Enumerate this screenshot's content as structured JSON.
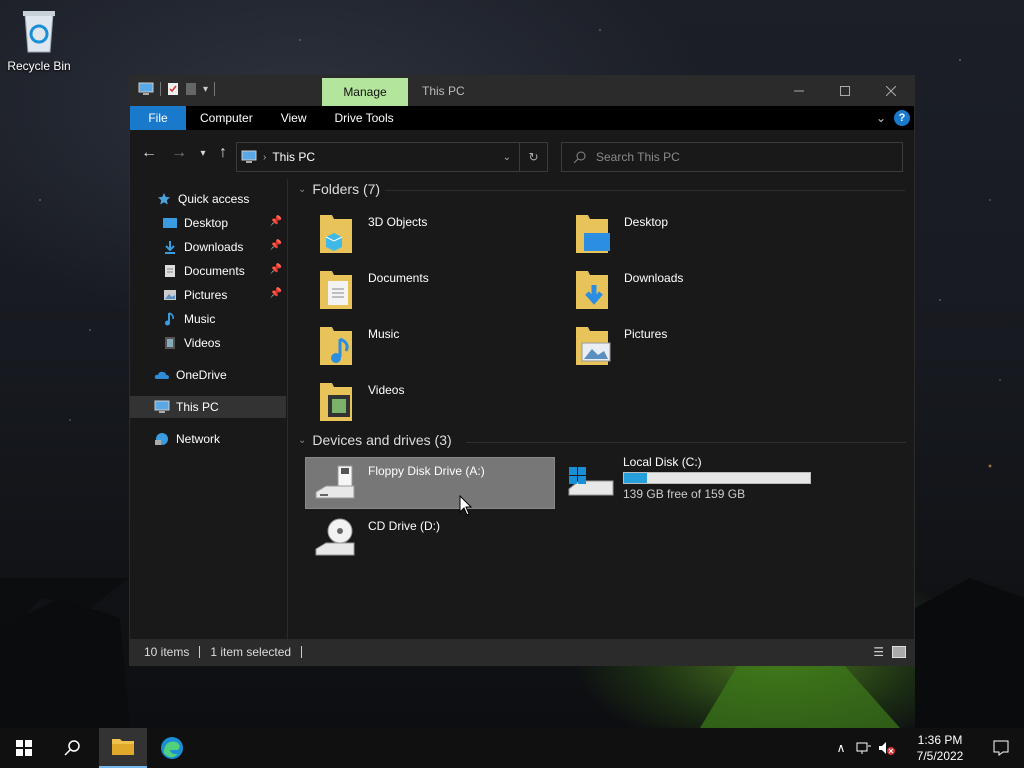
{
  "desktop": {
    "recycle_bin_label": "Recycle Bin"
  },
  "window": {
    "title": "This PC",
    "context_tab": "Manage",
    "ribbon_tabs": [
      "File",
      "Computer",
      "View",
      "Drive Tools"
    ],
    "help_label": "?"
  },
  "address": {
    "breadcrumb": "This PC",
    "search_placeholder": "Search This PC"
  },
  "nav": {
    "quick_access": "Quick access",
    "items": [
      {
        "label": "Desktop",
        "pinned": true
      },
      {
        "label": "Downloads",
        "pinned": true
      },
      {
        "label": "Documents",
        "pinned": true
      },
      {
        "label": "Pictures",
        "pinned": true
      },
      {
        "label": "Music",
        "pinned": false
      },
      {
        "label": "Videos",
        "pinned": false
      }
    ],
    "onedrive": "OneDrive",
    "this_pc": "This PC",
    "network": "Network"
  },
  "folders": {
    "header": "Folders (7)",
    "items": [
      "3D Objects",
      "Desktop",
      "Documents",
      "Downloads",
      "Music",
      "Pictures",
      "Videos"
    ]
  },
  "devices": {
    "header": "Devices and drives (3)",
    "floppy": "Floppy Disk Drive (A:)",
    "local_disk": {
      "label": "Local Disk (C:)",
      "free_text": "139 GB free of 159 GB",
      "used_fraction": 0.126
    },
    "cd": "CD Drive (D:)"
  },
  "status": {
    "item_count": "10 items",
    "selected": "1 item selected"
  },
  "taskbar": {
    "time": "1:36 PM",
    "date": "7/5/2022"
  },
  "colors": {
    "accent": "#1979ca",
    "manage_tab": "#b4e59c",
    "drive_bar": "#26a0da"
  }
}
